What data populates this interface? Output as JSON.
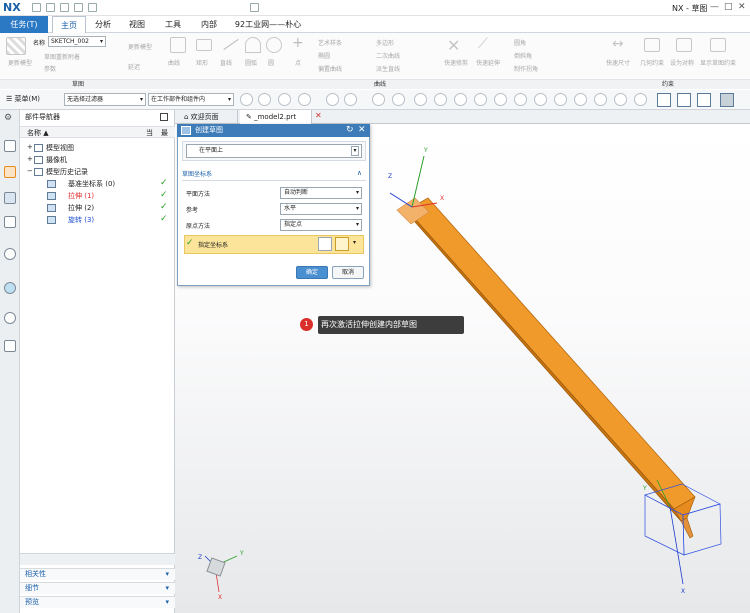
{
  "app": {
    "logo": "NX",
    "title": "NX - 草图"
  },
  "menubar": {
    "task": "任务(T)",
    "tabs": [
      "主页",
      "分析",
      "视图",
      "工具",
      "内部",
      "92工业网——朴心"
    ]
  },
  "ribbon": {
    "name_label": "名称",
    "sketch_name": "SKETCH_002",
    "finish": "完成",
    "sketch_group": "草图",
    "curve_group": "曲线",
    "constraint_group": "约束",
    "ghost_items": [
      "更新模型",
      "草图重新附着",
      "参数",
      "延迟",
      "曲线",
      "矩形",
      "多边形",
      "直线",
      "圆弧",
      "圆",
      "点",
      "艺术样条",
      "椭圆",
      "偏置曲线",
      "二次曲线",
      "派生直线",
      "快速修剪",
      "快速延伸",
      "圆角",
      "倒斜角",
      "制作拐角",
      "快速尺寸",
      "几何约束",
      "设为对称",
      "显示草图约束"
    ]
  },
  "toolbar": {
    "menu": "菜单(M)",
    "filter": "无选择过滤器",
    "scope": "在工作部件和组件内"
  },
  "nav": {
    "title": "部件导航器",
    "col_name": "名称",
    "col_a": "当",
    "col_b": "最",
    "rows": [
      {
        "label": "模型视图",
        "indent": 0,
        "color": "#222",
        "check": false
      },
      {
        "label": "摄像机",
        "indent": 0,
        "color": "#222",
        "check": false
      },
      {
        "label": "模型历史记录",
        "indent": 0,
        "color": "#222",
        "check": false
      },
      {
        "label": "基准坐标系 (0)",
        "indent": 1,
        "color": "#222",
        "check": true
      },
      {
        "label": "拉伸 (1)",
        "indent": 1,
        "color": "#e03030",
        "check": true
      },
      {
        "label": "拉伸 (2)",
        "indent": 1,
        "color": "#222",
        "check": true
      },
      {
        "label": "旋转 (3)",
        "indent": 1,
        "color": "#1e50d2",
        "check": true
      }
    ],
    "bottom": [
      "相关性",
      "细节",
      "预览"
    ]
  },
  "doctabs": {
    "welcome": "欢迎页面",
    "model": "_model2.prt"
  },
  "dialog": {
    "title": "创建草图",
    "type_value": "在平面上",
    "section": "草图坐标系",
    "plane_label": "平面方法",
    "plane_value": "自动判断",
    "ref_label": "参考",
    "ref_value": "水平",
    "origin_label": "原点方法",
    "origin_value": "指定点",
    "csys_label": "指定坐标系",
    "ok": "确定",
    "cancel": "取消"
  },
  "callout": {
    "num": "1",
    "text": "再次激活拉伸创建内部草图"
  },
  "axes": {
    "x": "X",
    "y": "Y",
    "z": "Z",
    "xc": "XC",
    "yc": "YC",
    "zc": "ZC"
  },
  "colors": {
    "accent": "#2b78c4",
    "part": "#e88b1e",
    "check": "#2aa02a"
  }
}
